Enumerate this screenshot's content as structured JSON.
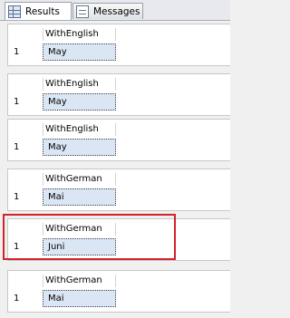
{
  "tabs": [
    {
      "label": "Results",
      "icon": "grid-icon",
      "active": true
    },
    {
      "label": "Messages",
      "icon": "messages-icon",
      "active": false
    }
  ],
  "result_sets": [
    {
      "column": "WithEnglish",
      "row_number": "1",
      "value": "May"
    },
    {
      "column": "WithEnglish",
      "row_number": "1",
      "value": "May"
    },
    {
      "column": "WithEnglish",
      "row_number": "1",
      "value": "May"
    },
    {
      "column": "WithGerman",
      "row_number": "1",
      "value": "Mai"
    },
    {
      "column": "WithGerman",
      "row_number": "1",
      "value": "Juni"
    },
    {
      "column": "WithGerman",
      "row_number": "1",
      "value": "Mai"
    }
  ],
  "highlight_color": "#d2232a",
  "cell_selection_color": "#dbe6f4"
}
